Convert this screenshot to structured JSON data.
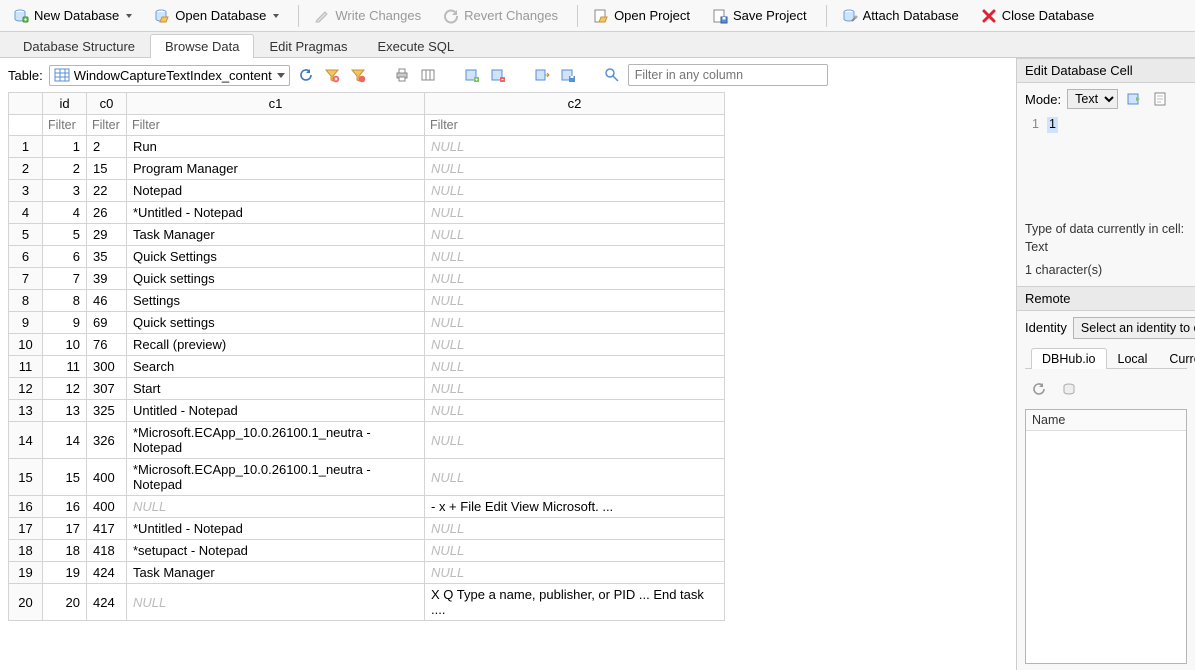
{
  "toolbar": {
    "new_db": "New Database",
    "open_db": "Open Database",
    "write_changes": "Write Changes",
    "revert_changes": "Revert Changes",
    "open_project": "Open Project",
    "save_project": "Save Project",
    "attach_db": "Attach Database",
    "close_db": "Close Database"
  },
  "tabs": {
    "structure": "Database Structure",
    "browse": "Browse Data",
    "pragmas": "Edit Pragmas",
    "sql": "Execute SQL"
  },
  "table_bar": {
    "label": "Table:",
    "selected": "WindowCaptureTextIndex_content",
    "filter_any_placeholder": "Filter in any column"
  },
  "grid": {
    "headers": {
      "rownum": "",
      "id": "id",
      "c0": "c0",
      "c1": "c1",
      "c2": "c2"
    },
    "filter_placeholder": "Filter",
    "rows": [
      {
        "n": "1",
        "id": "1",
        "c0": "2",
        "c1": "Run",
        "c2": null
      },
      {
        "n": "2",
        "id": "2",
        "c0": "15",
        "c1": "Program Manager",
        "c2": null
      },
      {
        "n": "3",
        "id": "3",
        "c0": "22",
        "c1": "Notepad",
        "c2": null
      },
      {
        "n": "4",
        "id": "4",
        "c0": "26",
        "c1": "*Untitled - Notepad",
        "c2": null
      },
      {
        "n": "5",
        "id": "5",
        "c0": "29",
        "c1": "Task Manager",
        "c2": null
      },
      {
        "n": "6",
        "id": "6",
        "c0": "35",
        "c1": "Quick Settings",
        "c2": null
      },
      {
        "n": "7",
        "id": "7",
        "c0": "39",
        "c1": "Quick settings",
        "c2": null
      },
      {
        "n": "8",
        "id": "8",
        "c0": "46",
        "c1": "Settings",
        "c2": null
      },
      {
        "n": "9",
        "id": "9",
        "c0": "69",
        "c1": "Quick settings",
        "c2": null
      },
      {
        "n": "10",
        "id": "10",
        "c0": "76",
        "c1": "Recall (preview)",
        "c2": null
      },
      {
        "n": "11",
        "id": "11",
        "c0": "300",
        "c1": "Search",
        "c2": null
      },
      {
        "n": "12",
        "id": "12",
        "c0": "307",
        "c1": "Start",
        "c2": null
      },
      {
        "n": "13",
        "id": "13",
        "c0": "325",
        "c1": "Untitled - Notepad",
        "c2": null
      },
      {
        "n": "14",
        "id": "14",
        "c0": "326",
        "c1": "*Microsoft.ECApp_10.0.26100.1_neutra - Notepad",
        "c2": null
      },
      {
        "n": "15",
        "id": "15",
        "c0": "400",
        "c1": "*Microsoft.ECApp_10.0.26100.1_neutra - Notepad",
        "c2": null
      },
      {
        "n": "16",
        "id": "16",
        "c0": "400",
        "c1": null,
        "c2": "- x + File Edit View Microsoft. ..."
      },
      {
        "n": "17",
        "id": "17",
        "c0": "417",
        "c1": "*Untitled - Notepad",
        "c2": null
      },
      {
        "n": "18",
        "id": "18",
        "c0": "418",
        "c1": "*setupact - Notepad",
        "c2": null
      },
      {
        "n": "19",
        "id": "19",
        "c0": "424",
        "c1": "Task Manager",
        "c2": null
      },
      {
        "n": "20",
        "id": "20",
        "c0": "424",
        "c1": null,
        "c2": "X Q Type a name, publisher, or PID ... End task ...."
      }
    ]
  },
  "edit_cell": {
    "title": "Edit Database Cell",
    "mode_label": "Mode:",
    "mode_value": "Text",
    "lineno": "1",
    "value": "1",
    "type_line": "Type of data currently in cell: Text",
    "char_line": "1 character(s)"
  },
  "remote": {
    "title": "Remote",
    "identity_label": "Identity",
    "identity_placeholder": "Select an identity to con",
    "tabs": {
      "dbhub": "DBHub.io",
      "local": "Local",
      "current": "Curren"
    },
    "list_header": "Name"
  }
}
